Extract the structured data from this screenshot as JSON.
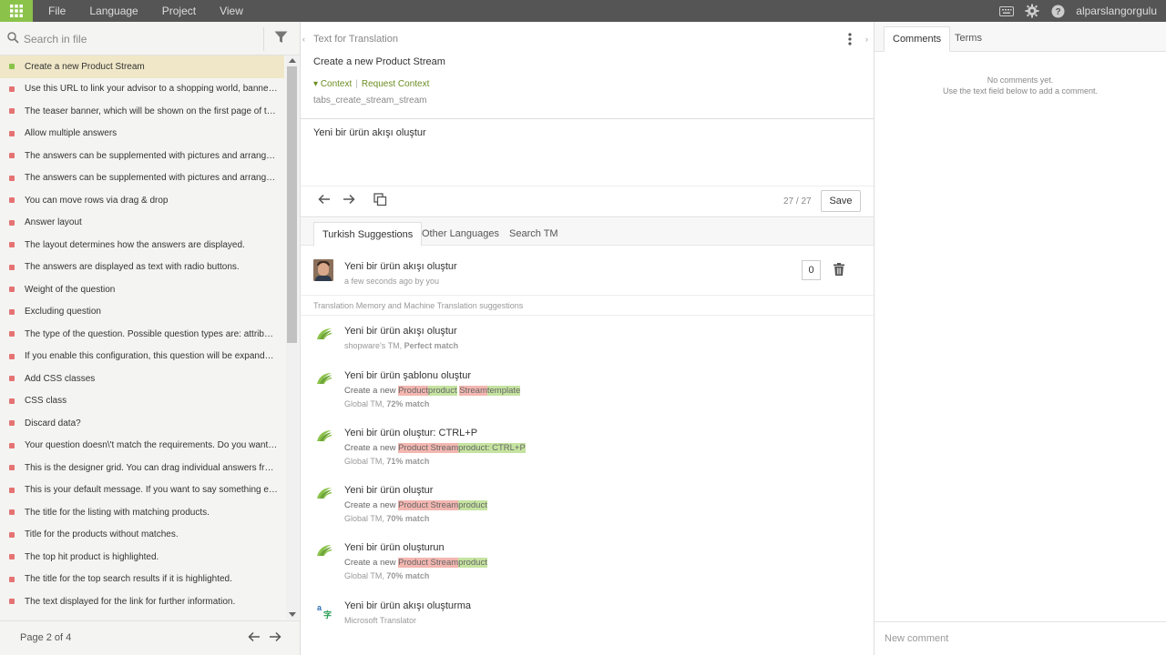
{
  "menu": {
    "items": [
      "File",
      "Language",
      "Project",
      "View"
    ],
    "user": "alparslangorgulu"
  },
  "colors": {
    "brand_green": "#8bc34a",
    "untranslated": "#e57373",
    "translated": "#8bc34a",
    "diff_removed": "#f3b6b0",
    "diff_added": "#c5e3a0"
  },
  "sidebar": {
    "search_placeholder": "Search in file",
    "pagination": "Page 2 of 4",
    "strings": [
      {
        "text": "Create a new Product Stream",
        "status": "translated",
        "active": true
      },
      {
        "text": "Use this URL to link your advisor to a shopping world, banner o...",
        "status": "untranslated"
      },
      {
        "text": "The teaser banner, which will be shown on the first page of the ...",
        "status": "untranslated"
      },
      {
        "text": "Allow multiple answers",
        "status": "untranslated"
      },
      {
        "text": "The answers can be supplemented with pictures and arranged i...",
        "status": "untranslated"
      },
      {
        "text": "The answers can be supplemented with pictures and arranged i...",
        "status": "untranslated"
      },
      {
        "text": "You can move rows via drag & drop",
        "status": "untranslated"
      },
      {
        "text": "Answer layout",
        "status": "untranslated"
      },
      {
        "text": "The layout determines how the answers are displayed.",
        "status": "untranslated"
      },
      {
        "text": "The answers are displayed as text with radio buttons.",
        "status": "untranslated"
      },
      {
        "text": "Weight of the question",
        "status": "untranslated"
      },
      {
        "text": "Excluding question",
        "status": "untranslated"
      },
      {
        "text": "The type of the question. Possible question types are: attribute,...",
        "status": "untranslated"
      },
      {
        "text": "If you enable this configuration, this question will be expanded ...",
        "status": "untranslated"
      },
      {
        "text": "Add CSS classes",
        "status": "untranslated"
      },
      {
        "text": "CSS class",
        "status": "untranslated"
      },
      {
        "text": "Discard data?",
        "status": "untranslated"
      },
      {
        "text": "Your question doesn\\'t match the requirements. Do you want t...",
        "status": "untranslated"
      },
      {
        "text": "This is the designer grid. You can drag individual answers from ...",
        "status": "untranslated"
      },
      {
        "text": "This is your default message. If you want to say something else,...",
        "status": "untranslated"
      },
      {
        "text": "The title for the listing with matching products.",
        "status": "untranslated"
      },
      {
        "text": "Title for the products without matches.",
        "status": "untranslated"
      },
      {
        "text": "The top hit product is highlighted.",
        "status": "untranslated"
      },
      {
        "text": "The title for the top search results if it is highlighted.",
        "status": "untranslated"
      },
      {
        "text": "The text displayed for the link for further information.",
        "status": "untranslated"
      }
    ]
  },
  "editor": {
    "source_label": "Text for Translation",
    "source_text": "Create a new Product Stream",
    "context_label": "Context",
    "request_context": "Request Context",
    "key": "tabs_create_stream_stream",
    "translation": "Yeni bir ürün akışı oluştur",
    "char_count": "27 / 27",
    "save_label": "Save"
  },
  "suggestions": {
    "tabs": [
      "Turkish Suggestions",
      "Other Languages",
      "Search TM"
    ],
    "own": {
      "text": "Yeni bir ürün akışı oluştur",
      "meta": "a few seconds ago by you",
      "votes": "0"
    },
    "tm_header": "Translation Memory and Machine Translation suggestions",
    "items": [
      {
        "text": "Yeni bir ürün akışı oluştur",
        "source_prefix": "",
        "del1": "",
        "ins1": "",
        "mid": "",
        "del2": "",
        "ins2": "",
        "origin": "shopware's TM, ",
        "match": "Perfect match",
        "logo": "tm"
      },
      {
        "text": "Yeni bir ürün şablonu oluştur",
        "source_prefix": "Create a new ",
        "del1": "Product",
        "ins1": "product",
        "mid": " ",
        "del2": "Stream",
        "ins2": "template",
        "origin": "Global TM, ",
        "match": "72% match",
        "logo": "tm"
      },
      {
        "text": "Yeni bir ürün oluştur: CTRL+P",
        "source_prefix": "Create a new ",
        "del1": "Product Stream",
        "ins1": "product: CTRL+P",
        "mid": "",
        "del2": "",
        "ins2": "",
        "origin": "Global TM, ",
        "match": "71% match",
        "logo": "tm"
      },
      {
        "text": "Yeni bir ürün oluştur",
        "source_prefix": "Create a new ",
        "del1": "Product Stream",
        "ins1": "product",
        "mid": "",
        "del2": "",
        "ins2": "",
        "origin": "Global TM, ",
        "match": "70% match",
        "logo": "tm"
      },
      {
        "text": "Yeni bir ürün oluşturun",
        "source_prefix": "Create a new ",
        "del1": "Product Stream",
        "ins1": "product",
        "mid": "",
        "del2": "",
        "ins2": "",
        "origin": "Global TM, ",
        "match": "70% match",
        "logo": "tm"
      },
      {
        "text": "Yeni bir ürün akışı oluşturma",
        "source_prefix": "",
        "del1": "",
        "ins1": "",
        "mid": "",
        "del2": "",
        "ins2": "",
        "origin": "Microsoft Translator",
        "match": "",
        "logo": "ms"
      }
    ]
  },
  "comments": {
    "tabs": [
      "Comments",
      "Terms"
    ],
    "empty_title": "No comments yet.",
    "empty_hint": "Use the text field below to add a comment.",
    "new_placeholder": "New comment"
  }
}
